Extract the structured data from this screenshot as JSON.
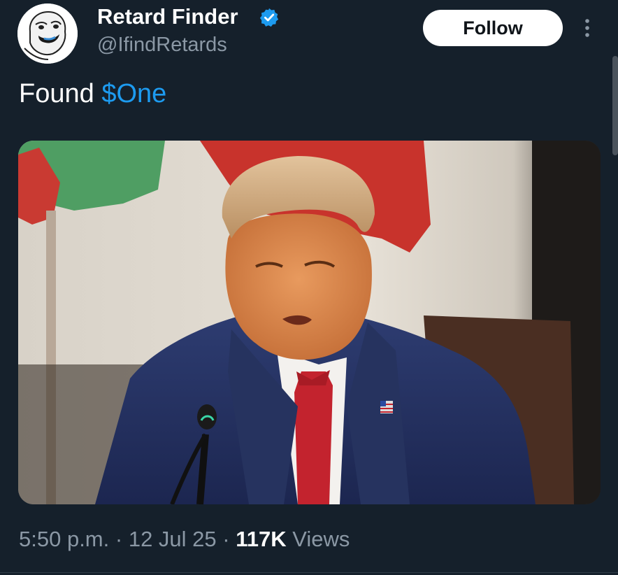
{
  "author": {
    "display_name": "Retard Finder",
    "handle": "@IfindRetards",
    "verified": true,
    "avatar_icon": "meme-face-avatar-icon"
  },
  "actions": {
    "follow_label": "Follow",
    "more_icon": "more-vertical-icon"
  },
  "tweet": {
    "text_prefix": "Found ",
    "cashtag": "$One"
  },
  "media": {
    "icon": "photo-man-in-suit-at-microphone"
  },
  "meta": {
    "time": "5:50 p.m.",
    "separator": "·",
    "date": "12 Jul 25",
    "views_count": "117K",
    "views_label": "Views"
  },
  "colors": {
    "background": "#15202b",
    "link": "#1d9bf0",
    "secondary_text": "#8b98a5",
    "verified": "#1d9bf0"
  }
}
